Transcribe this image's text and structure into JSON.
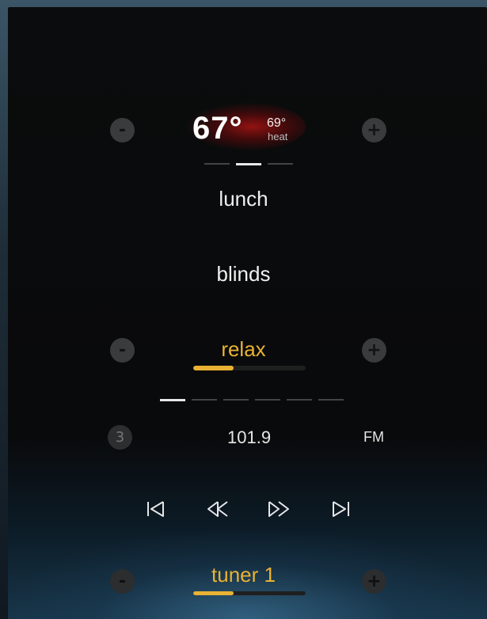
{
  "thermostat": {
    "current_temp": "67°",
    "setpoint": "69°",
    "mode": "heat",
    "minus_label": "-",
    "plus_label": "+"
  },
  "scenes": {
    "page_indicator": {
      "count": 3,
      "active": 1
    },
    "items": [
      "lunch",
      "blinds"
    ]
  },
  "lighting": {
    "label": "relax",
    "level_percent": 36,
    "minus_label": "-",
    "plus_label": "+"
  },
  "presets": {
    "count": 6,
    "active": 0
  },
  "radio": {
    "preset_number": "3",
    "frequency": "101.9",
    "band": "FM"
  },
  "transport": [
    "skip-back-icon",
    "rewind-icon",
    "fast-forward-icon",
    "skip-forward-icon"
  ],
  "source": {
    "label": "tuner 1",
    "volume_percent": 36,
    "minus_label": "-",
    "plus_label": "+"
  },
  "colors": {
    "accent": "#e9b234",
    "text": "#f0f0f0",
    "button": "#3a3b3c"
  }
}
